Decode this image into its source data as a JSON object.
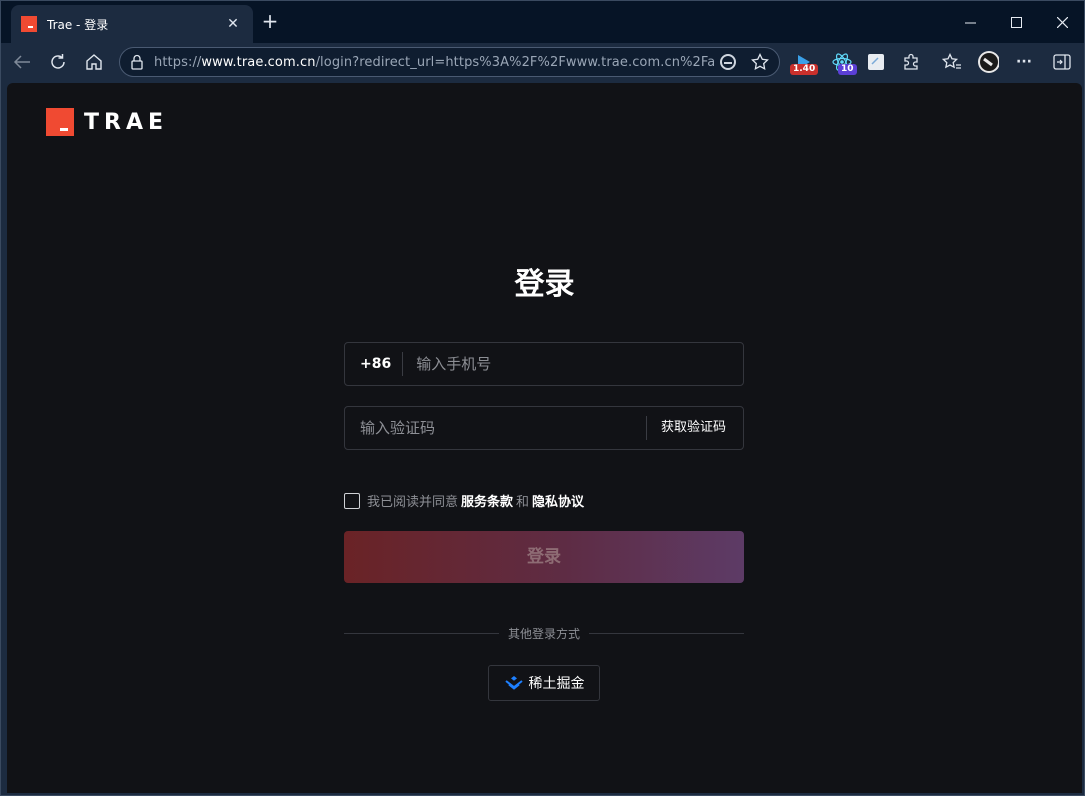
{
  "browser": {
    "tab_title": "Trae - 登录",
    "tab_close": "✕",
    "new_tab": "+",
    "url_scheme": "https://",
    "url_host": "www.trae.com.cn",
    "url_rest": "/login?redirect_url=https%3A%2F%2Fwww.trae.com.cn%2Fauth...",
    "extensions": [
      {
        "name": "video-extension",
        "badge": "1.40",
        "badge_color": "#c9302c"
      },
      {
        "name": "react-devtools",
        "badge": "10",
        "badge_color": "#5b3fd6"
      }
    ],
    "menu_glyph": "···"
  },
  "brand": {
    "logo_text": "TRAE",
    "accent": "#f04a32"
  },
  "login": {
    "title": "登录",
    "country_code": "+86",
    "phone_placeholder": "输入手机号",
    "code_placeholder": "输入验证码",
    "get_code": "获取验证码",
    "agree_prefix": "我已阅读并同意",
    "terms": "服务条款",
    "and": "和",
    "privacy": "隐私协议",
    "submit": "登录",
    "other_methods": "其他登录方式",
    "juejin": "稀土掘金"
  }
}
